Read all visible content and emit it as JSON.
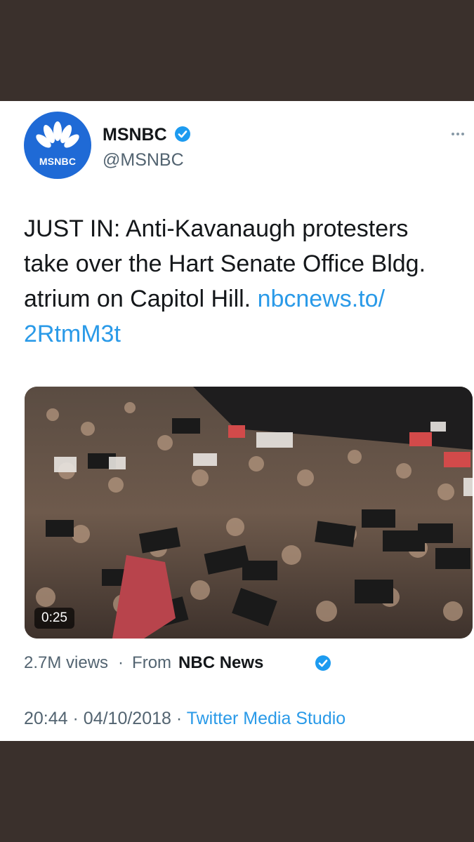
{
  "account": {
    "display_name": "MSNBC",
    "handle": "@MSNBC",
    "avatar_text": "MSNBC",
    "verified": true
  },
  "tweet": {
    "text": "JUST IN: Anti-Kavanaugh protesters take over the Hart Senate Office Bldg. atrium on Capitol Hill.",
    "link_part1": "nbcnews.to/",
    "link_part2": "2RtmM3t"
  },
  "media": {
    "duration": "0:25",
    "description_icon": "video-thumbnail"
  },
  "stats": {
    "views": "2.7M views",
    "separator": "·",
    "from_label": "From",
    "source": "NBC News"
  },
  "footer": {
    "time": "20:44",
    "date": "04/10/2018",
    "separator": "·",
    "client": "Twitter Media Studio"
  },
  "colors": {
    "link": "#2a9ae8",
    "verified": "#1d9bf0",
    "avatar_bg": "#1f6ad6",
    "page_bg": "#3a302c"
  }
}
